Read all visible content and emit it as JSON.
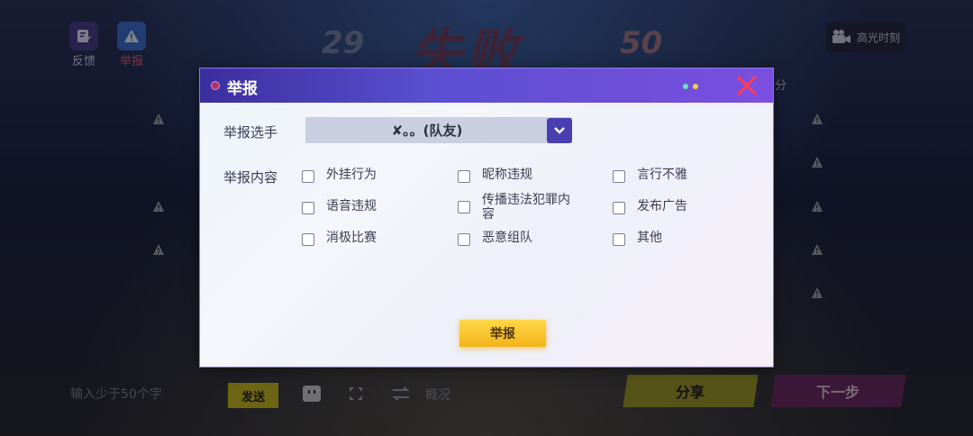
{
  "top": {
    "feedback_label": "反馈",
    "report_label": "举报",
    "score_left": "29",
    "result_text": "失败",
    "score_right": "50",
    "highlight_label": "高光时刻",
    "right_header_fragment": "分"
  },
  "bottom": {
    "chat_placeholder": "输入少于50个字",
    "send_label": "发送",
    "overview_label": "概况",
    "share_label": "分享",
    "next_label": "下一步"
  },
  "dialog": {
    "title": "举报",
    "player_label": "举报选手",
    "player_value": "✘。。(队友)",
    "content_label": "举报内容",
    "options": [
      "外挂行为",
      "昵称违规",
      "言行不雅",
      "语音违规",
      "传播违法犯罪内容",
      "发布广告",
      "消极比赛",
      "恶意组队",
      "其他"
    ],
    "submit_label": "举报"
  },
  "colors": {
    "header_start": "#3b2e9e",
    "header_end": "#7b4fe0",
    "accent_close": "#e8304f",
    "submit_yellow": "#f3b319",
    "select_button": "#4a3fb0"
  },
  "icons": [
    "feedback-icon",
    "warning-icon",
    "video-camera-icon",
    "close-icon",
    "chevron-down-icon",
    "emoji-icon",
    "expand-icon",
    "swap-icon"
  ]
}
